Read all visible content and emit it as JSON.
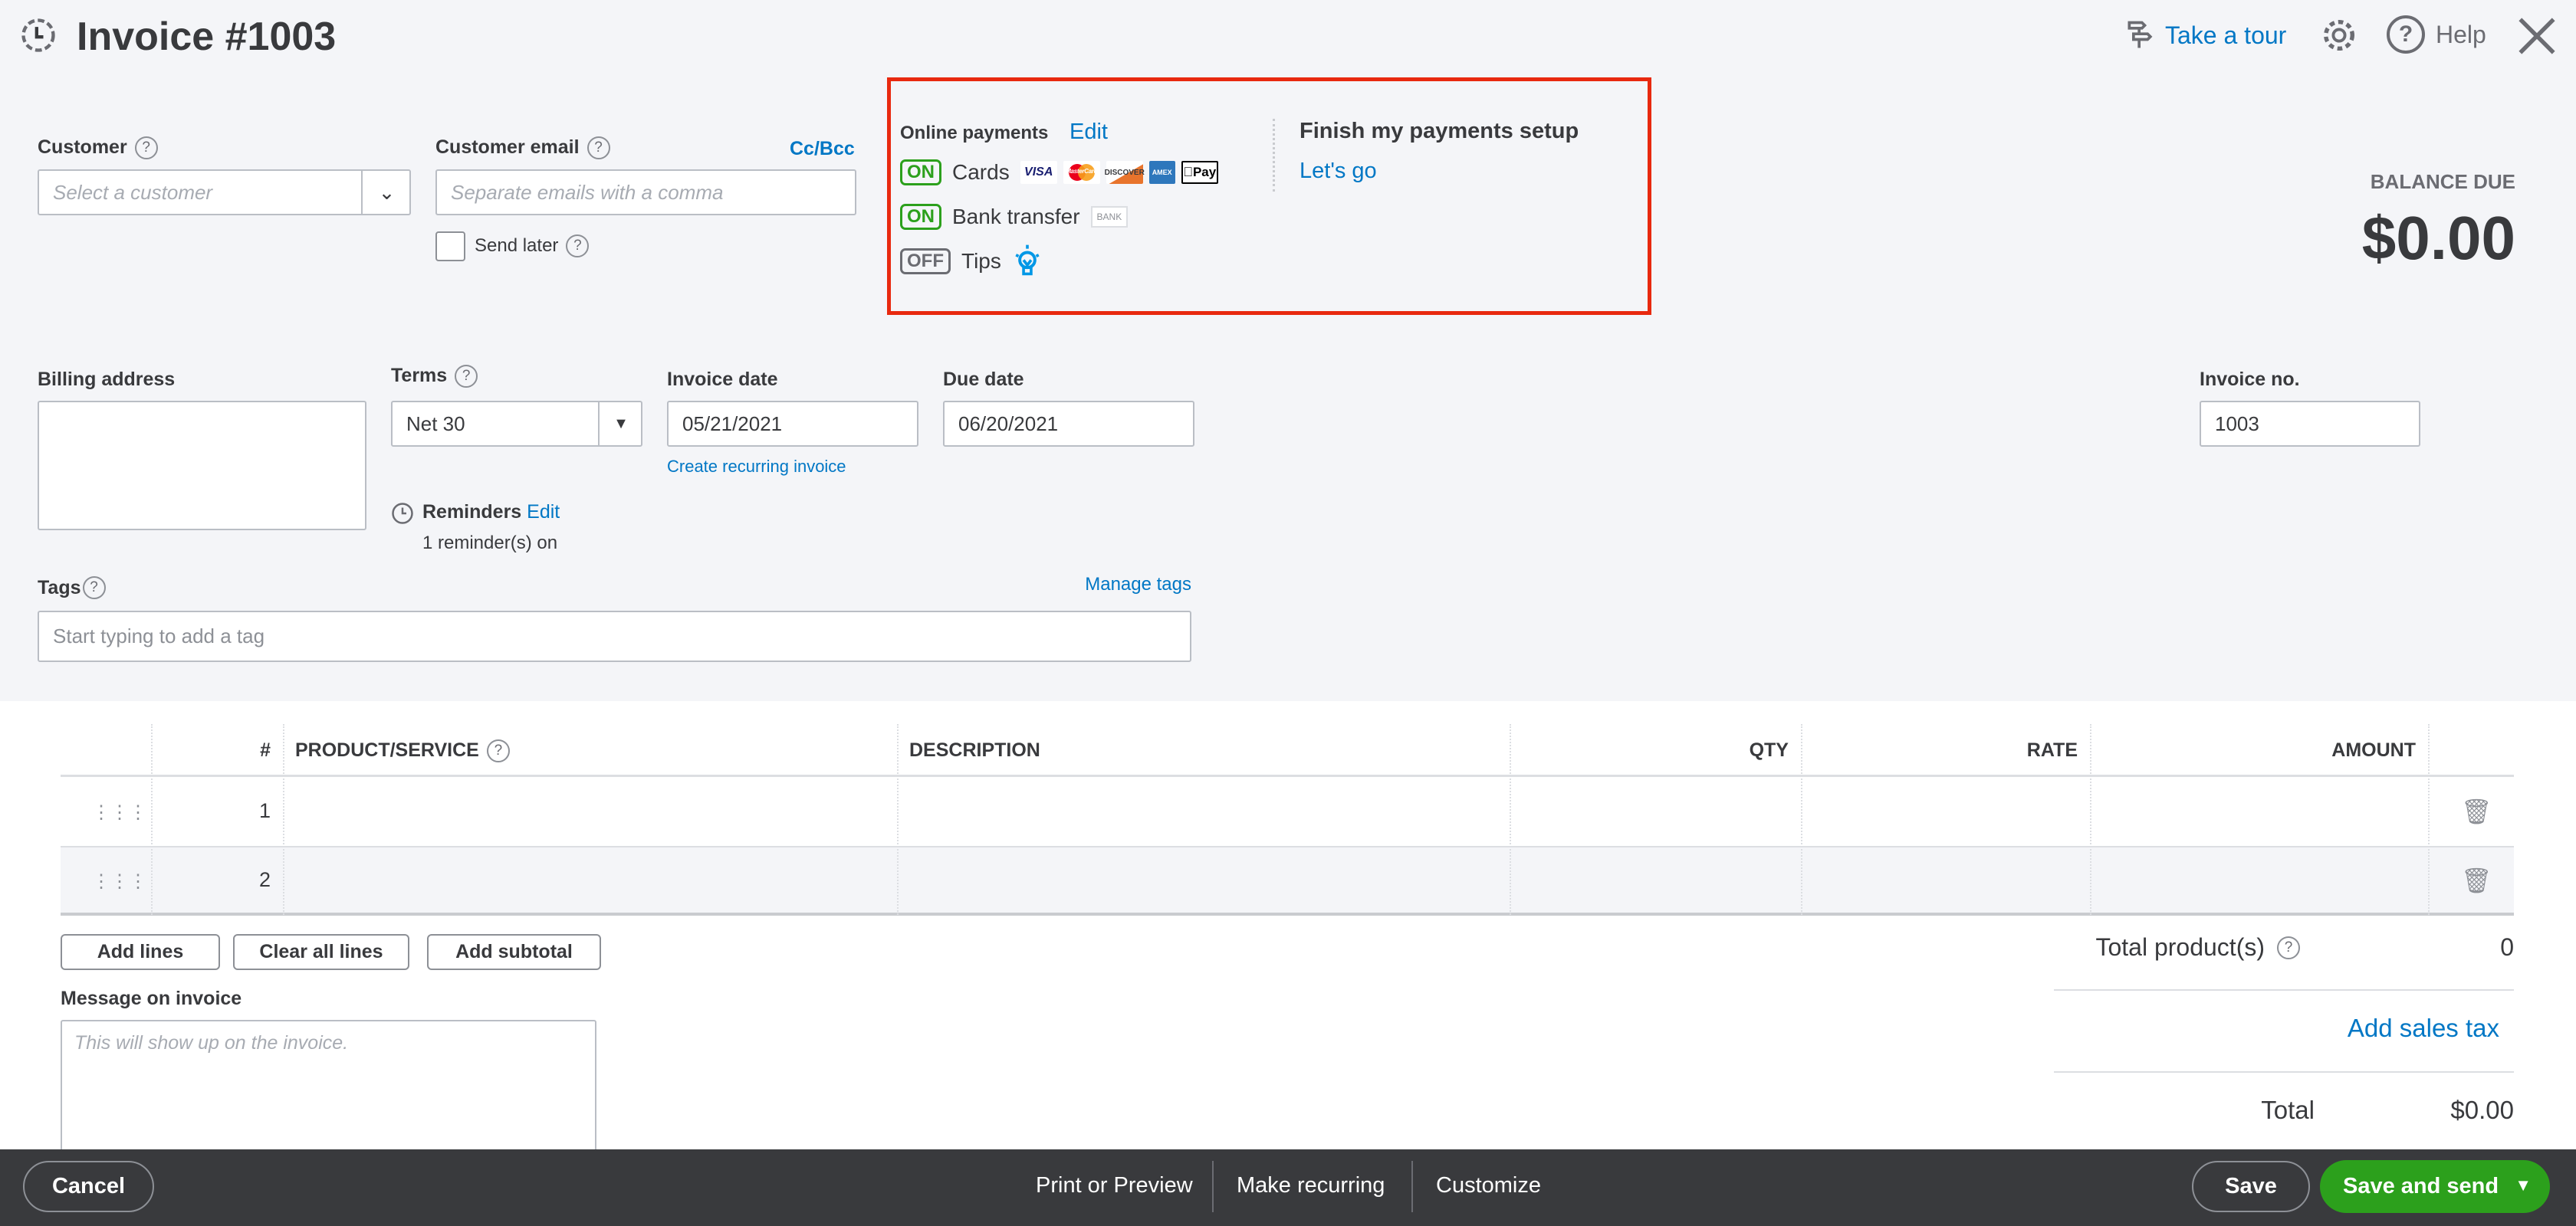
{
  "header": {
    "title": "Invoice #1003",
    "take_tour": "Take a tour",
    "help": "Help"
  },
  "customer": {
    "label": "Customer",
    "placeholder": "Select a customer"
  },
  "email": {
    "label": "Customer email",
    "ccbcc": "Cc/Bcc",
    "placeholder": "Separate emails with a comma",
    "send_later": "Send later",
    "send_later_checked": false
  },
  "payments": {
    "title": "Online payments",
    "edit": "Edit",
    "cards": {
      "state": "ON",
      "label": "Cards",
      "brands": [
        "VISA",
        "MasterCard",
        "DISCOVER",
        "AMEX",
        "Pay"
      ]
    },
    "bank": {
      "state": "ON",
      "label": "Bank transfer",
      "badge": "BANK"
    },
    "tips": {
      "state": "OFF",
      "label": "Tips"
    },
    "finish": "Finish my payments setup",
    "lets_go": "Let's go",
    "highlight_color": "#e8290f"
  },
  "balance": {
    "label": "BALANCE DUE",
    "amount": "$0.00"
  },
  "billing": {
    "label": "Billing address"
  },
  "terms": {
    "label": "Terms",
    "value": "Net 30"
  },
  "invoice_date": {
    "label": "Invoice date",
    "value": "05/21/2021",
    "recurring": "Create recurring invoice"
  },
  "due_date": {
    "label": "Due date",
    "value": "06/20/2021"
  },
  "invoice_no": {
    "label": "Invoice no.",
    "value": "1003"
  },
  "reminders": {
    "label": "Reminders",
    "edit": "Edit",
    "status": "1 reminder(s) on"
  },
  "tags": {
    "label": "Tags",
    "manage": "Manage tags",
    "placeholder": "Start typing to add a tag"
  },
  "table": {
    "headers": [
      "#",
      "PRODUCT/SERVICE",
      "DESCRIPTION",
      "QTY",
      "RATE",
      "AMOUNT"
    ],
    "rows": [
      {
        "n": "1"
      },
      {
        "n": "2"
      }
    ]
  },
  "buttons": {
    "add_lines": "Add lines",
    "clear_lines": "Clear all lines",
    "add_subtotal": "Add subtotal"
  },
  "message": {
    "label": "Message on invoice",
    "placeholder": "This will show up on the invoice."
  },
  "totals": {
    "products_label": "Total product(s)",
    "products_value": "0",
    "add_tax": "Add sales tax",
    "total_label": "Total",
    "total_value": "$0.00"
  },
  "footer": {
    "cancel": "Cancel",
    "print": "Print or Preview",
    "recurring": "Make recurring",
    "customize": "Customize",
    "save": "Save",
    "save_send": "Save and send"
  }
}
